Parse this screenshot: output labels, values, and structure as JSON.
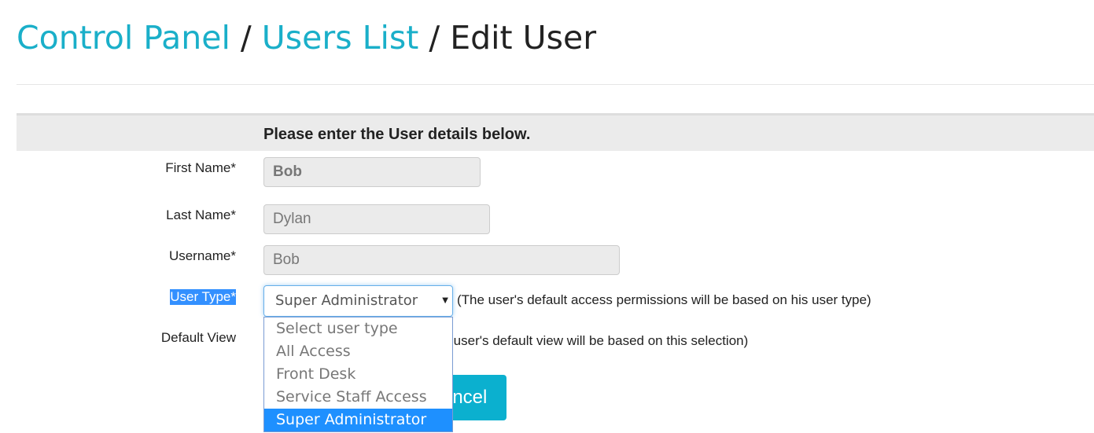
{
  "breadcrumb": {
    "items": [
      "Control Panel",
      "Users List"
    ],
    "current": "Edit User",
    "separator": "/"
  },
  "form": {
    "heading": "Please enter the User details below.",
    "first_name": {
      "label": "First Name*",
      "value": "Bob"
    },
    "last_name": {
      "label": "Last Name*",
      "value": "Dylan"
    },
    "username": {
      "label": "Username*",
      "value": "Bob"
    },
    "user_type": {
      "label": "User Type*",
      "value": "Super Administrator",
      "help": "(The user's default access permissions will be based on his user type)",
      "options": [
        "Select user type",
        "All Access",
        "Front Desk",
        "Service Staff Access",
        "Super Administrator"
      ]
    },
    "default_view": {
      "label": "Default View",
      "help": "(The user's default view will be based on this selection)"
    },
    "cancel_label": "Cancel"
  },
  "colors": {
    "link": "#1aafc9",
    "button": "#0bb0cf",
    "selected_option": "#1e90ff"
  }
}
